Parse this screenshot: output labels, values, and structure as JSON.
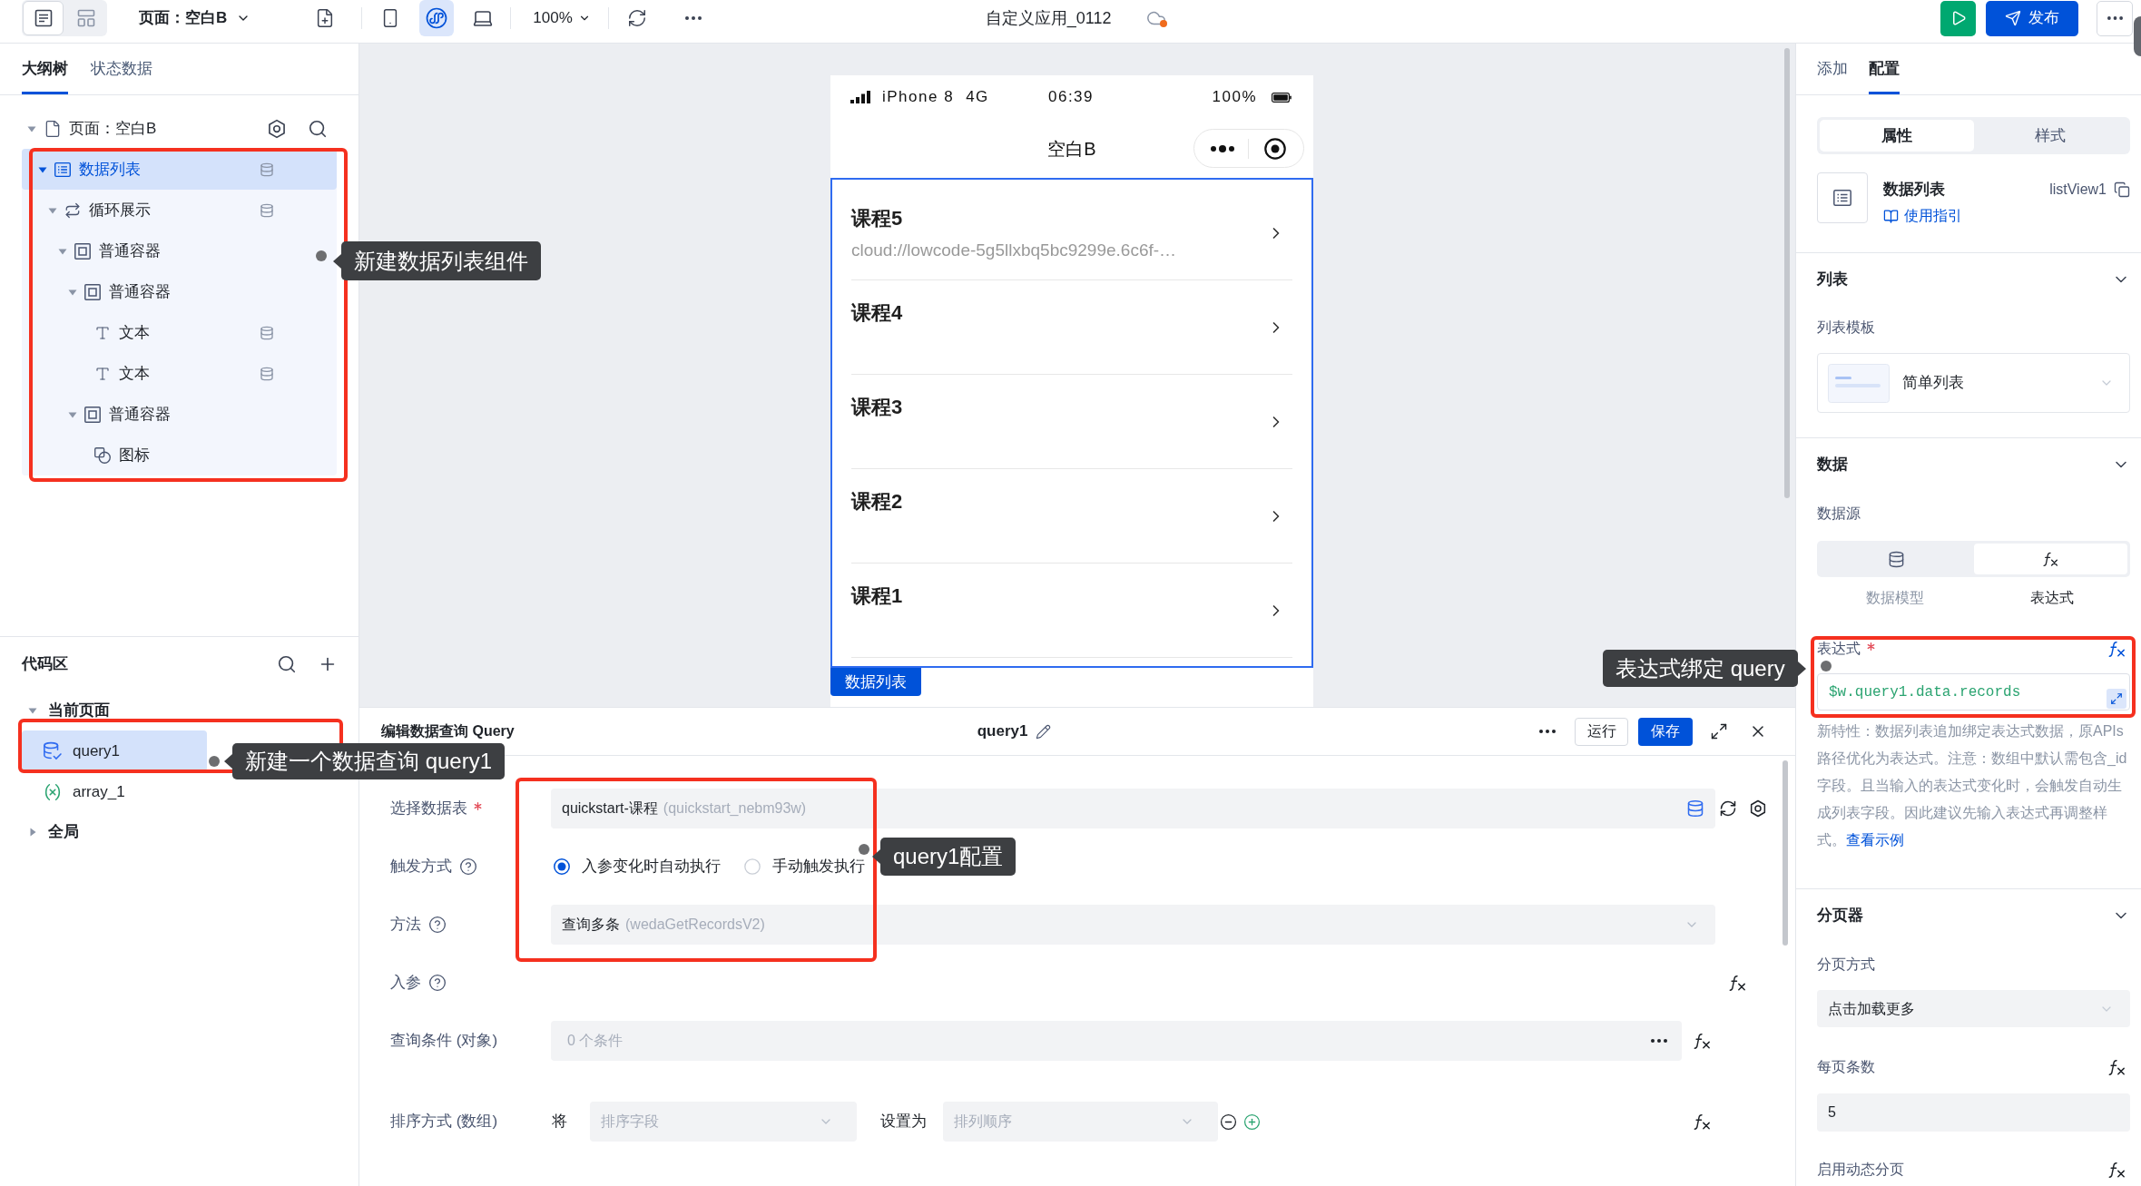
{
  "toolbar": {
    "view_toggles": [
      {
        "kind": "outline",
        "selected": true
      },
      {
        "kind": "layout",
        "selected": false
      }
    ],
    "page_selector": "页面：空白B",
    "device_modes": [
      {
        "kind": "phone",
        "selected": false
      },
      {
        "kind": "miniprogram",
        "selected": true
      },
      {
        "kind": "desktop",
        "selected": false
      }
    ],
    "zoom": "100%",
    "app_title": "自定义应用_0112",
    "cloud_sync_alert": true,
    "publish_button": "发布"
  },
  "outline_panel": {
    "tabs": [
      {
        "label": "大纲树",
        "selected": true
      },
      {
        "label": "状态数据",
        "selected": false
      }
    ],
    "tree": {
      "label": "页面：空白B",
      "kind": "page",
      "selected": false,
      "expanded": true,
      "children": [
        {
          "label": "数据列表",
          "kind": "list",
          "selected": true,
          "expanded": true,
          "bound": true,
          "children": [
            {
              "label": "循环展示",
              "kind": "loop",
              "selected": false,
              "expanded": true,
              "bound": true,
              "children": [
                {
                  "label": "普通容器",
                  "kind": "container",
                  "selected": false,
                  "expanded": true,
                  "bound": false,
                  "children": [
                    {
                      "label": "普通容器",
                      "kind": "container",
                      "selected": false,
                      "expanded": true,
                      "bound": false,
                      "children": [
                        {
                          "label": "文本",
                          "kind": "text",
                          "selected": false,
                          "bound": true
                        },
                        {
                          "label": "文本",
                          "kind": "text",
                          "selected": false,
                          "bound": true
                        }
                      ]
                    },
                    {
                      "label": "普通容器",
                      "kind": "container",
                      "selected": false,
                      "expanded": true,
                      "bound": false,
                      "children": [
                        {
                          "label": "图标",
                          "kind": "icon",
                          "selected": false,
                          "bound": false
                        }
                      ]
                    }
                  ]
                }
              ]
            }
          ]
        }
      ]
    },
    "callout": "新建数据列表组件"
  },
  "code_panel": {
    "title": "代码区",
    "groups": [
      {
        "label": "当前页面",
        "expanded": true,
        "items": [
          {
            "label": "query1",
            "kind": "query",
            "selected": true
          },
          {
            "label": "array_1",
            "kind": "variable",
            "selected": false
          }
        ]
      },
      {
        "label": "全局",
        "expanded": false
      }
    ],
    "callout": "新建一个数据查询 query1"
  },
  "canvas": {
    "phone": {
      "device": "iPhone 8",
      "network": "4G",
      "time": "06:39",
      "battery": "100%",
      "page_title": "空白B",
      "list_items": [
        {
          "title": "课程5",
          "subtitle": "cloud://lowcode-5g5llxbq5bc9299e.6c6f-…"
        },
        {
          "title": "课程4"
        },
        {
          "title": "课程3"
        },
        {
          "title": "课程2"
        },
        {
          "title": "课程1"
        }
      ],
      "selection_tag": "数据列表"
    }
  },
  "query_editor": {
    "title": "编辑数据查询 Query",
    "name": "query1",
    "run_button": "运行",
    "save_button": "保存",
    "fields": [
      {
        "kind": "table_select",
        "label": "选择数据表",
        "required": true,
        "help": false,
        "value": "quickstart-课程",
        "hint": "(quickstart_nebm93w)"
      },
      {
        "kind": "radio",
        "label": "触发方式",
        "required": false,
        "help": true,
        "options": [
          {
            "label": "入参变化时自动执行",
            "selected": true
          },
          {
            "label": "手动触发执行",
            "selected": false
          }
        ]
      },
      {
        "kind": "select",
        "label": "方法",
        "required": false,
        "help": true,
        "value": "查询多条",
        "hint": "(wedaGetRecordsV2)"
      },
      {
        "kind": "params",
        "label": "入参",
        "required": false,
        "help": true,
        "formula": true
      },
      {
        "kind": "conditions",
        "label": "查询条件 (对象)",
        "required": false,
        "help": false,
        "placeholder": "0 个条件",
        "formula": true
      },
      {
        "kind": "sort",
        "label": "排序方式 (数组)",
        "required": false,
        "help": false,
        "prefix": "将",
        "field_placeholder": "排序字段",
        "connector": "设置为",
        "order_placeholder": "排列顺序",
        "formula": true
      }
    ],
    "callout": "query1配置"
  },
  "config_panel": {
    "tabs": [
      {
        "label": "添加",
        "selected": false
      },
      {
        "label": "配置",
        "selected": true
      }
    ],
    "mode_tabs": [
      {
        "label": "属性",
        "selected": true
      },
      {
        "label": "样式",
        "selected": false
      }
    ],
    "component": {
      "name": "数据列表",
      "guide_link": "使用指引",
      "id": "listView1"
    },
    "sections": [
      {
        "title": "列表",
        "expanded": true,
        "fields": [
          {
            "kind": "template_select",
            "label": "列表模板",
            "value": "简单列表"
          }
        ]
      },
      {
        "title": "数据",
        "expanded": true,
        "fields": [
          {
            "kind": "source_switch",
            "label": "数据源",
            "options": [
              {
                "kind": "model",
                "label": "数据模型",
                "selected": false
              },
              {
                "kind": "expression",
                "label": "表达式",
                "selected": true
              }
            ]
          },
          {
            "kind": "expression",
            "label": "表达式",
            "required": true,
            "formula": true,
            "value": "$w.query1.data.records",
            "note": "新特性：数据列表追加绑定表达式数据，原APIs路径优化为表达式。注意：数组中默认需包含_id字段。且当输入的表达式变化时，会触发自动生成列表字段。因此建议先输入表达式再调整样式。",
            "note_link": "查看示例"
          }
        ]
      },
      {
        "title": "分页器",
        "expanded": true,
        "fields": [
          {
            "kind": "select",
            "label": "分页方式",
            "value": "点击加载更多"
          },
          {
            "kind": "input",
            "label": "每页条数",
            "formula": true,
            "value": "5"
          },
          {
            "kind": "label_only",
            "label": "启用动态分页",
            "formula": true
          }
        ]
      }
    ],
    "callout": "表达式绑定 query"
  }
}
